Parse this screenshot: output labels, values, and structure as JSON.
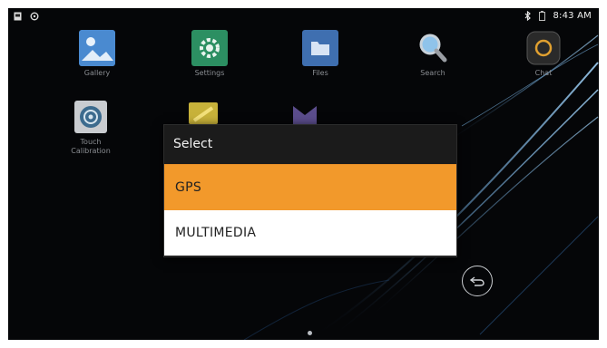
{
  "status_bar": {
    "time": "8:43 AM"
  },
  "apps": [
    {
      "label": "Gallery"
    },
    {
      "label": "Settings"
    },
    {
      "label": "Files"
    },
    {
      "label": "Search"
    },
    {
      "label": "Chat"
    },
    {
      "label": "Touch\nCalibration"
    }
  ],
  "dialog": {
    "title": "Select",
    "options": [
      {
        "label": "GPS",
        "selected": true
      },
      {
        "label": "MULTIMEDIA",
        "selected": false
      }
    ]
  },
  "colors": {
    "selected": "#f2992b",
    "dialog_bg": "#1b1b1b",
    "screen_bg": "#050608"
  },
  "page_indicator": {
    "current": 1,
    "total": 1
  }
}
